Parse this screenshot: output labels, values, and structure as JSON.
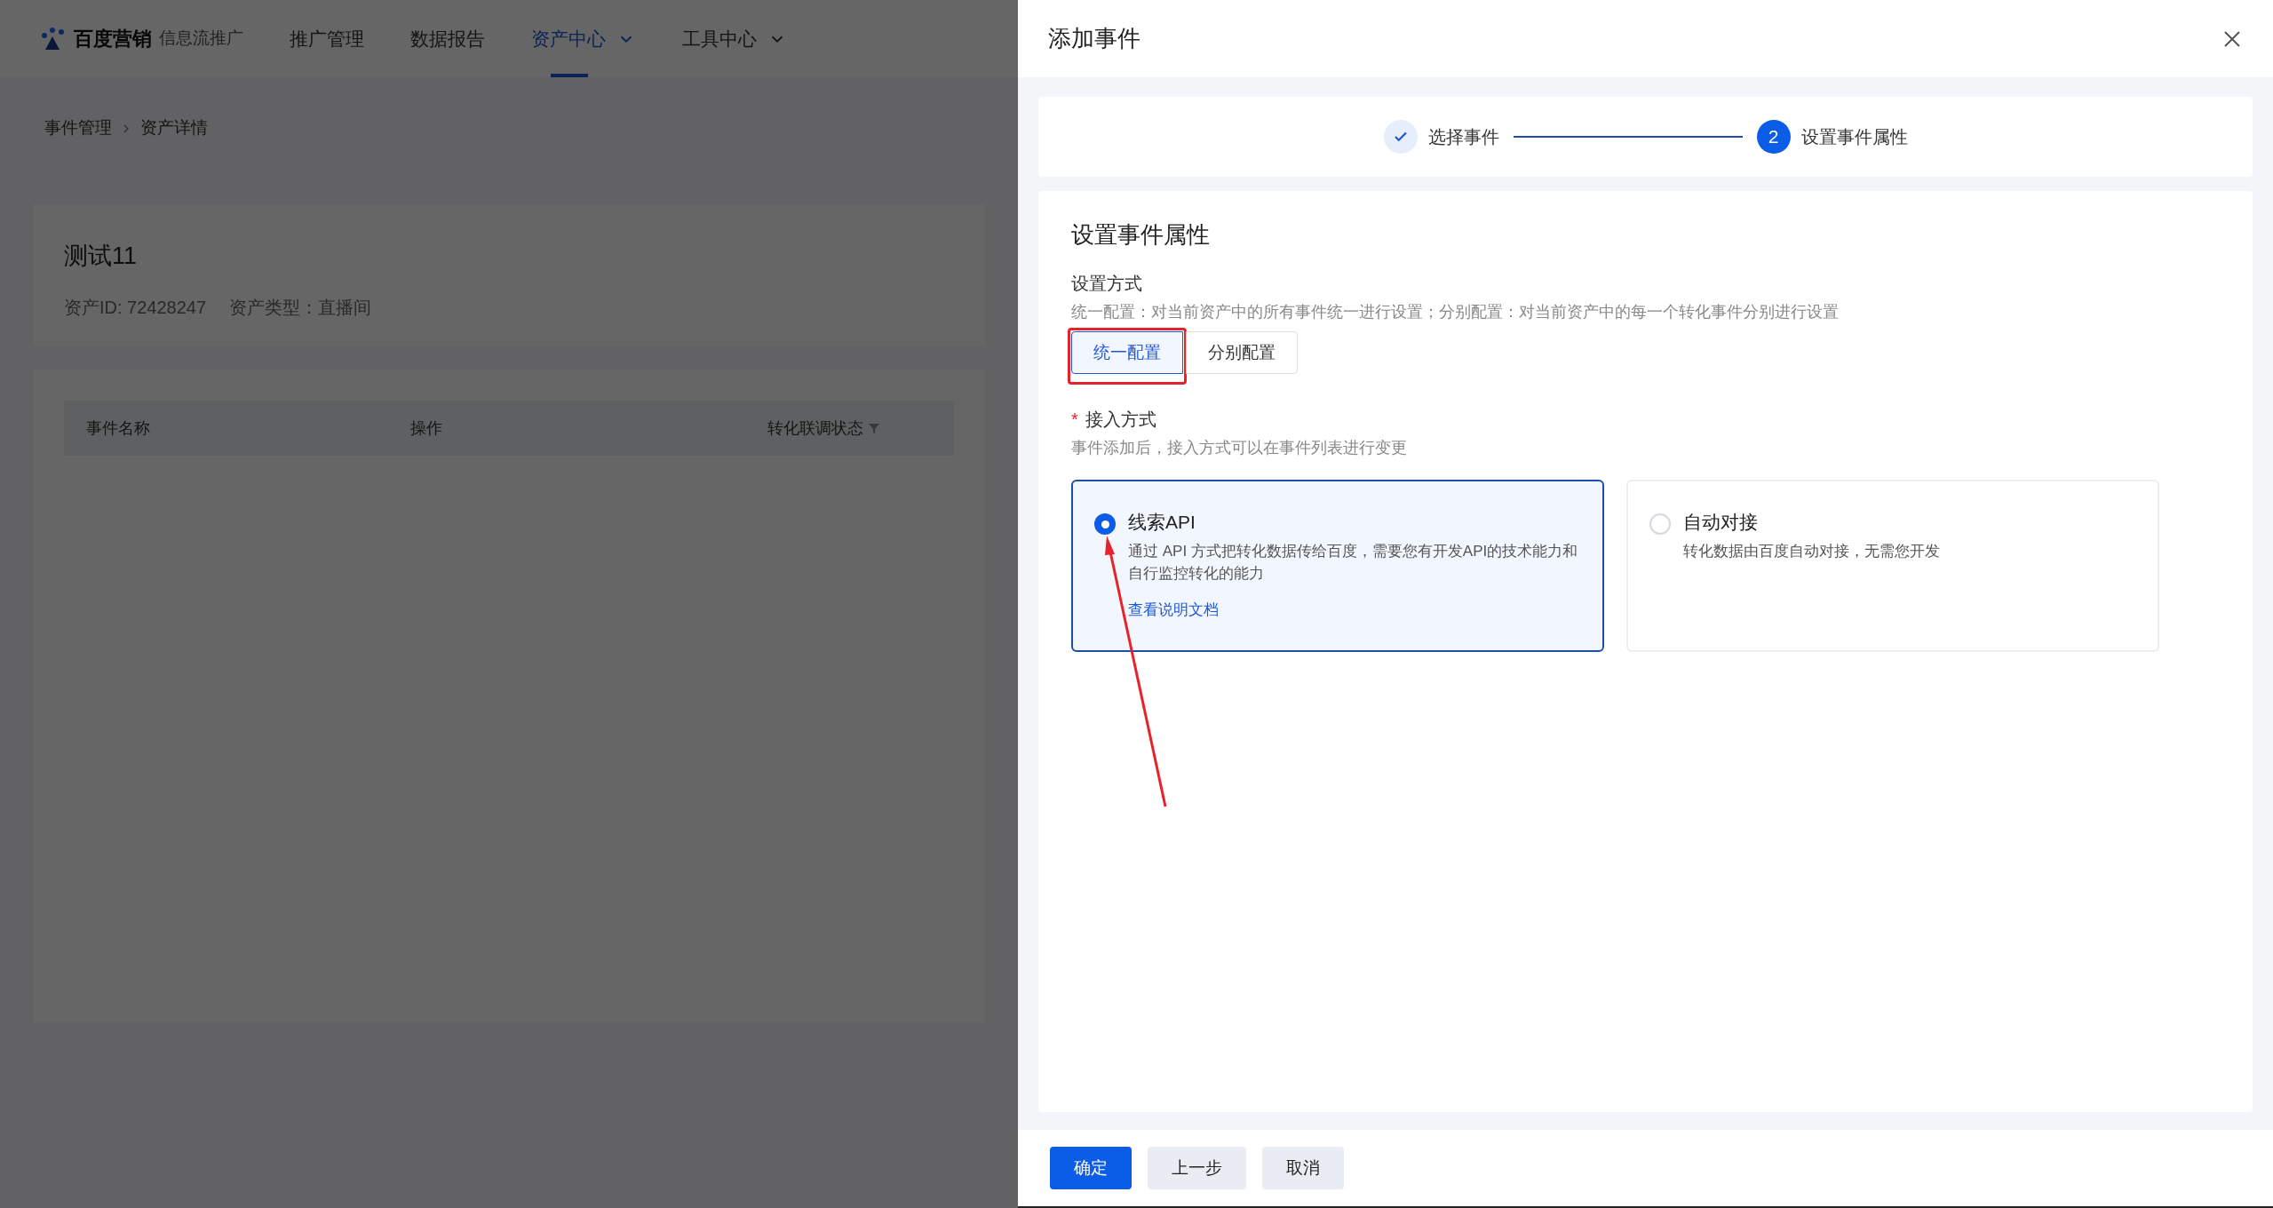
{
  "top_nav": {
    "logo_text": "百度营销",
    "product": "信息流推广",
    "items": [
      {
        "label": "推广管理",
        "selected": false,
        "dropdown": false
      },
      {
        "label": "数据报告",
        "selected": false,
        "dropdown": false
      },
      {
        "label": "资产中心",
        "selected": true,
        "dropdown": true
      },
      {
        "label": "工具中心",
        "selected": false,
        "dropdown": true
      }
    ]
  },
  "breadcrumb": [
    "事件管理",
    "资产详情"
  ],
  "asset": {
    "title": "测试11",
    "id_text": "资产ID: 72428247",
    "type_text": "资产类型：直播间"
  },
  "table": {
    "columns": [
      "事件名称",
      "操作",
      "转化联调状态"
    ]
  },
  "drawer": {
    "title": "添加事件",
    "steps": [
      {
        "label": "选择事件",
        "done": true
      },
      {
        "label": "设置事件属性",
        "number": "2",
        "done": false
      }
    ],
    "section_title": "设置事件属性",
    "mode": {
      "label": "设置方式",
      "hint": "统一配置：对当前资产中的所有事件统一进行设置；分别配置：对当前资产中的每一个转化事件分别进行设置",
      "options": [
        {
          "label": "统一配置",
          "selected": true,
          "highlighted": true
        },
        {
          "label": "分别配置",
          "selected": false,
          "highlighted": false
        }
      ]
    },
    "access": {
      "label": "接入方式",
      "required_mark": "*",
      "hint": "事件添加后，接入方式可以在事件列表进行变更",
      "options": [
        {
          "title": "线索API",
          "description": "通过 API 方式把转化数据传给百度，需要您有开发API的技术能力和自行监控转化的能力",
          "link": "查看说明文档",
          "selected": true,
          "arrow": true
        },
        {
          "title": "自动对接",
          "description": "转化数据由百度自动对接，无需您开发",
          "selected": false,
          "arrow": false
        }
      ]
    },
    "buttons": [
      {
        "label": "确定",
        "kind": "primary"
      },
      {
        "label": "上一步",
        "kind": "secondary"
      },
      {
        "label": "取消",
        "kind": "secondary"
      }
    ]
  }
}
